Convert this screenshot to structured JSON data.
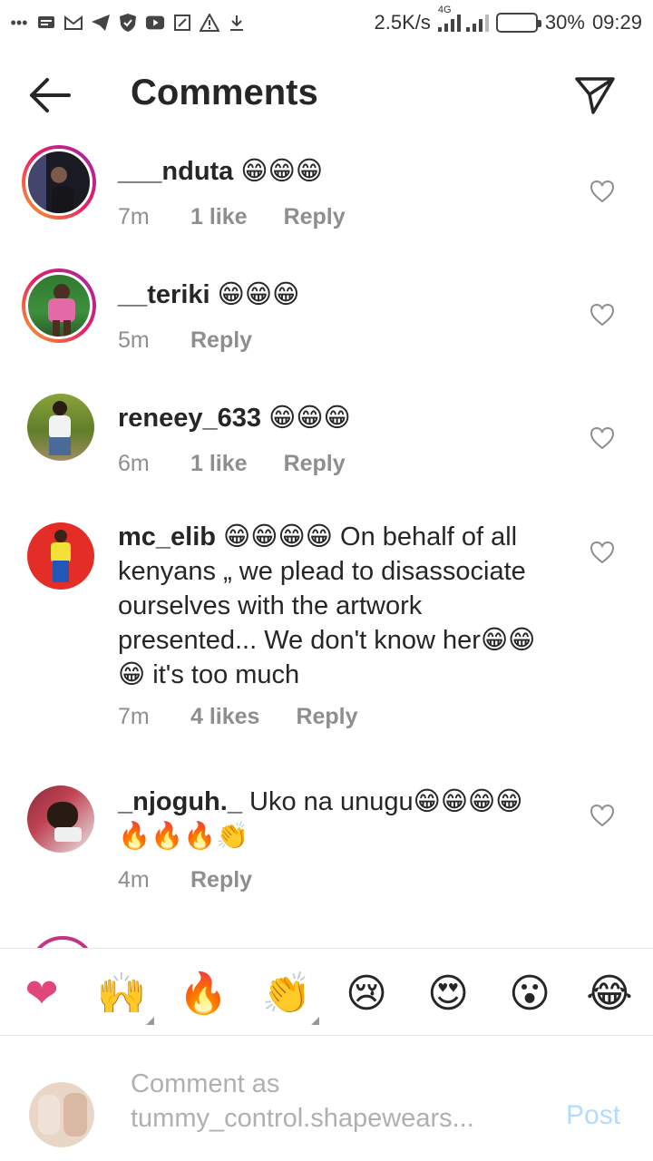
{
  "status_bar": {
    "net_speed": "2.5K/s",
    "network_type": "4G",
    "battery_percent": "30%",
    "battery_level": 0.3,
    "time": "09:29",
    "icons": [
      "more-icon",
      "message-icon",
      "gmail-icon",
      "telegram-icon",
      "shield-icon",
      "youtube-icon",
      "screenshot-icon",
      "warning-icon",
      "download-icon"
    ]
  },
  "header": {
    "title": "Comments",
    "back_icon": "arrow-left-icon",
    "share_icon": "paper-plane-icon"
  },
  "comments": [
    {
      "user": "___nduta",
      "text": " 😁😁😁",
      "time": "7m",
      "likes": "1 like",
      "reply": "Reply",
      "ring": true
    },
    {
      "user": "__teriki",
      "text": " 😁😁😁",
      "time": "5m",
      "likes": "",
      "reply": "Reply",
      "ring": true
    },
    {
      "user": "reneey_633",
      "text": " 😁😁😁",
      "time": "6m",
      "likes": "1 like",
      "reply": "Reply",
      "ring": false
    },
    {
      "user": "mc_elib",
      "text": " 😁😁😁😁 On behalf of all kenyans „ we plead to disassociate ourselves with the artwork presented... We don't know her😁😁😁 it's too much",
      "time": "7m",
      "likes": "4 likes",
      "reply": "Reply",
      "ring": false
    },
    {
      "user": "_njoguh._",
      "text": " Uko na unugu😁😁😁😁🔥🔥🔥👏",
      "time": "4m",
      "likes": "",
      "reply": "Reply",
      "ring": false
    }
  ],
  "emoji_bar": [
    "❤",
    "🙌",
    "🔥",
    "👏",
    "😢",
    "😍",
    "😮",
    "😂"
  ],
  "composer": {
    "placeholder": "Comment as tummy_control.shapewears...",
    "post_label": "Post"
  },
  "colors": {
    "text": "#262626",
    "meta": "#8e8e8e",
    "post_disabled": "#b3dbff",
    "heart_emoji": "#e0457b"
  }
}
